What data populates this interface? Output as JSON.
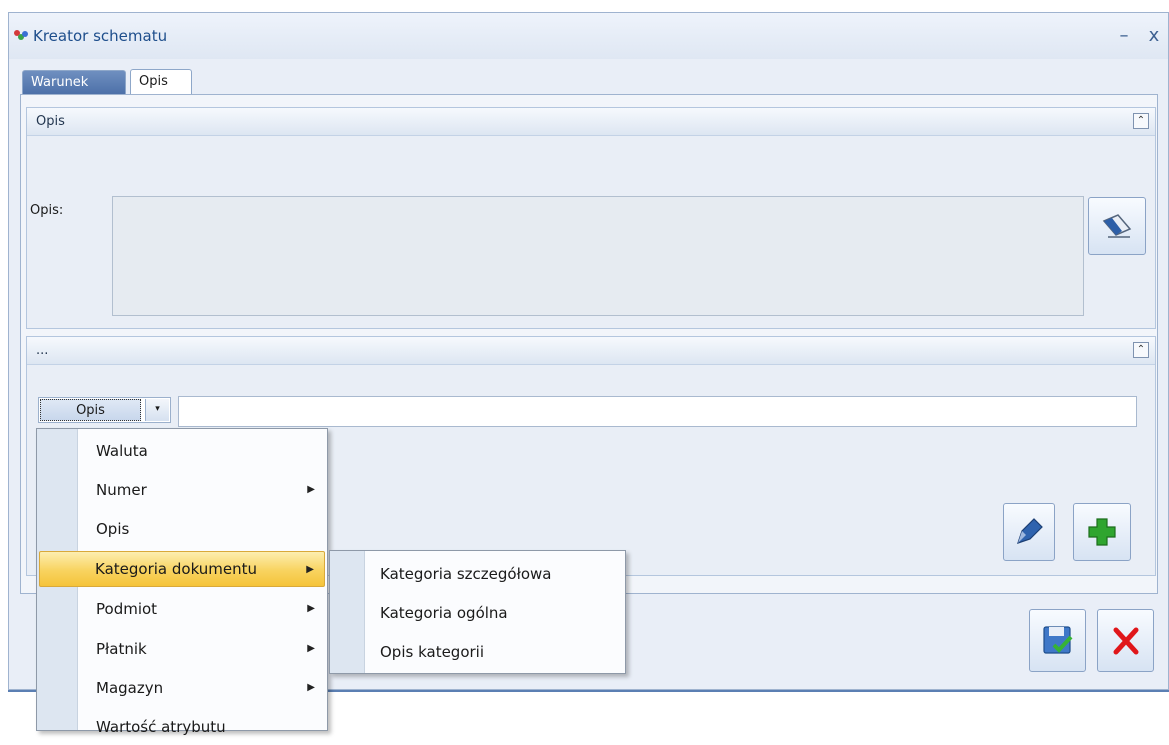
{
  "window": {
    "title": "Kreator schematu",
    "minimize_label": "–",
    "close_label": "x"
  },
  "tabs": [
    {
      "label": "Warunek",
      "active": false
    },
    {
      "label": "Opis",
      "active": true
    }
  ],
  "group_opis": {
    "title": "Opis",
    "collapse_glyph": "≈",
    "field_label": "Opis:",
    "field_value": "",
    "edit_icon": "eraser-icon"
  },
  "group_more": {
    "title": "...",
    "collapse_glyph": "≈",
    "combo_value": "Opis",
    "combo_arrow": "▾",
    "input_value": "",
    "pen_icon": "pen-icon",
    "add_icon": "plus-icon"
  },
  "footer": {
    "save_icon": "save-icon",
    "cancel_icon": "cancel-icon"
  },
  "menu": {
    "items": [
      {
        "label": "Waluta",
        "submenu": false
      },
      {
        "label": "Numer",
        "submenu": true
      },
      {
        "label": "Opis",
        "submenu": false
      },
      {
        "label": "Kategoria dokumentu",
        "submenu": true,
        "highlighted": true
      },
      {
        "label": "Podmiot",
        "submenu": true
      },
      {
        "label": "Płatnik",
        "submenu": true
      },
      {
        "label": "Magazyn",
        "submenu": true
      },
      {
        "label": "Wartość atrybutu",
        "submenu": false
      }
    ],
    "arrow_glyph": "▶"
  },
  "submenu": {
    "items": [
      {
        "label": "Kategoria szczegółowa"
      },
      {
        "label": "Kategoria ogólna"
      },
      {
        "label": "Opis kategorii"
      }
    ]
  },
  "colors": {
    "accent": "#1e4e8c",
    "menu_highlight": "#f8d35f",
    "add_green": "#2fa52f",
    "cancel_red": "#e0161a"
  }
}
